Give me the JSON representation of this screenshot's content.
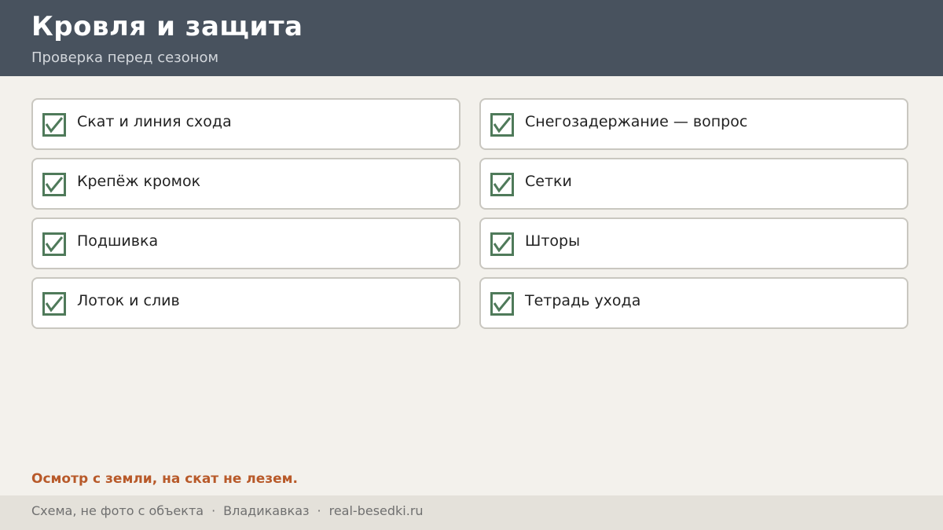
{
  "header": {
    "title": "Кровля и защита",
    "subtitle": "Проверка перед сезоном"
  },
  "checklist": {
    "check_color": "#4f7a5a",
    "items": [
      {
        "label": "Скат и линия схода",
        "checked": true
      },
      {
        "label": "Снегозадержание — вопрос",
        "checked": true
      },
      {
        "label": "Крепёж кромок",
        "checked": true
      },
      {
        "label": "Сетки",
        "checked": true
      },
      {
        "label": "Подшивка",
        "checked": true
      },
      {
        "label": "Шторы",
        "checked": true
      },
      {
        "label": "Лоток и слив",
        "checked": true
      },
      {
        "label": "Тетрадь ухода",
        "checked": true
      }
    ]
  },
  "warning": {
    "text": "Осмотр с земли, на скат не лезем.",
    "color": "#b85a2a"
  },
  "footer": {
    "note": "Схема, не фото с объекта",
    "separator": "·",
    "city": "Владикавказ",
    "site": "real-besedki.ru"
  }
}
